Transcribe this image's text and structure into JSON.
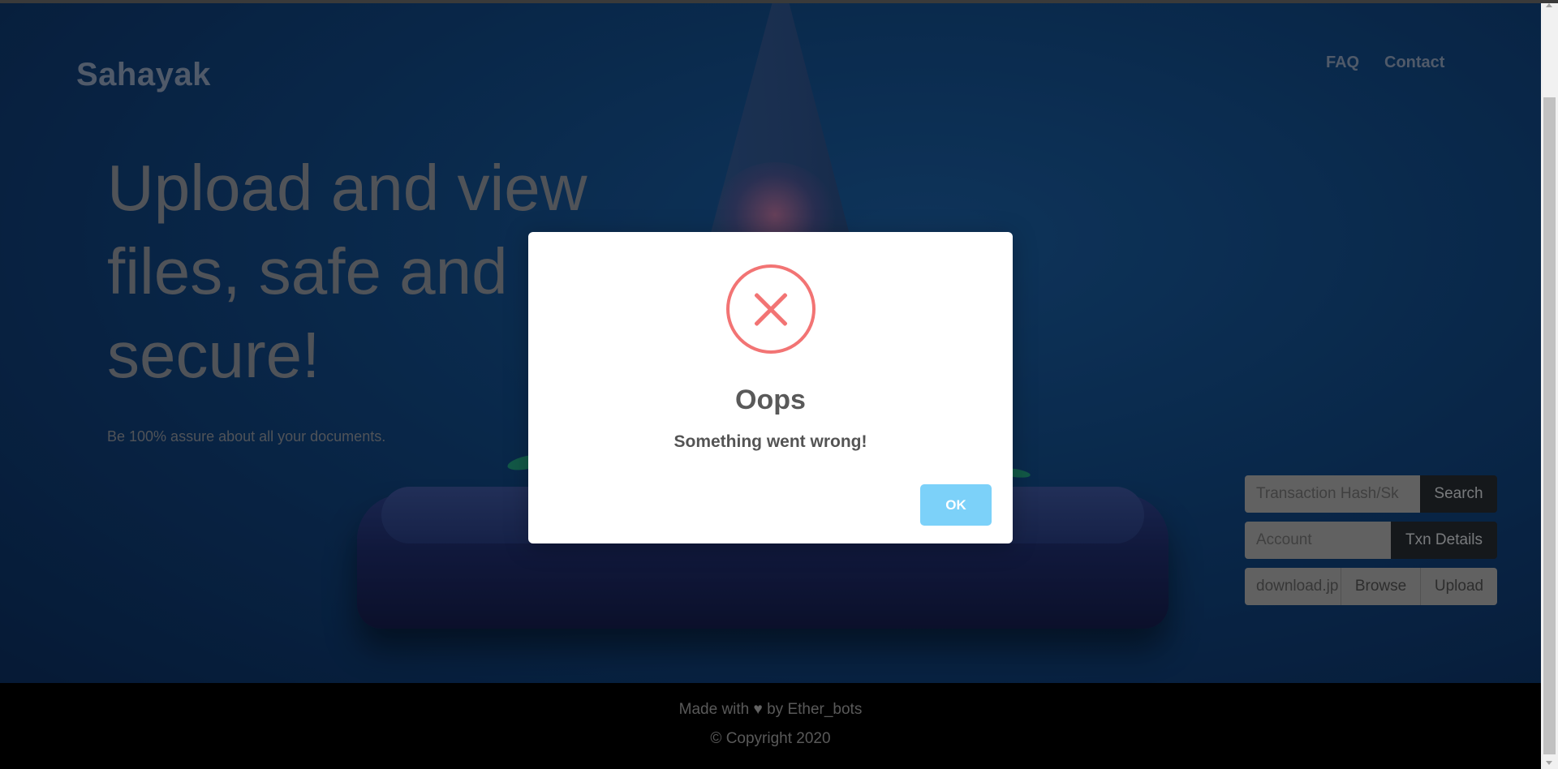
{
  "header": {
    "logo": "Sahayak",
    "nav": {
      "faq": "FAQ",
      "contact": "Contact"
    }
  },
  "hero": {
    "headline": "Upload and view files, safe and secure!",
    "tagline": "Be 100% assure about all your documents."
  },
  "search": {
    "placeholder": "Transaction Hash/Sk",
    "button": "Search"
  },
  "txn": {
    "placeholder": "Account",
    "button": "Txn Details"
  },
  "upload": {
    "file_name": "download.jp",
    "browse": "Browse",
    "upload": "Upload"
  },
  "footer": {
    "made_prefix": "Made with",
    "heart": "♥",
    "made_suffix": "by Ether_bots",
    "copyright": "© Copyright 2020"
  },
  "modal": {
    "icon": "error-x-icon",
    "title": "Oops",
    "text": "Something went wrong!",
    "ok": "OK",
    "error_color": "#f27474",
    "ok_color": "#7cd1f9"
  }
}
